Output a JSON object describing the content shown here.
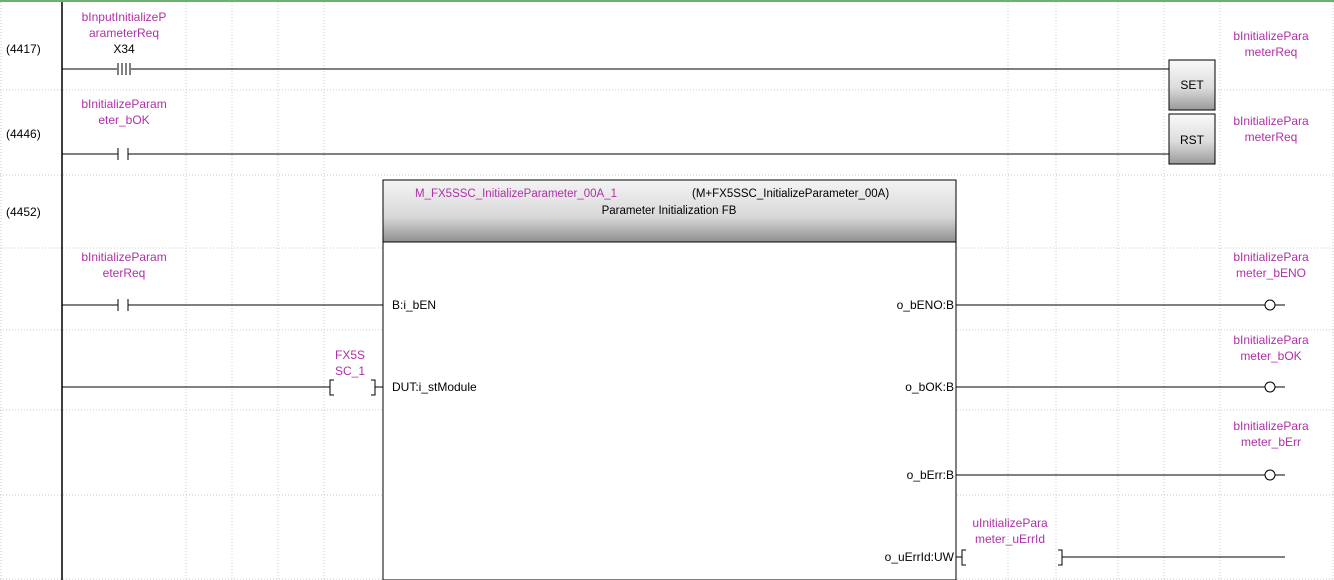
{
  "colors": {
    "variable": "#b030a8",
    "grid": "#b8b8b8",
    "top_border": "#3a9a3a",
    "coil_box_top": "#fafafa",
    "coil_box_bottom": "#9a9a9a",
    "fb_header_top": "#f4f4f4",
    "fb_header_bottom": "#8e8e8e",
    "fb_title": "#b030a8"
  },
  "rungs": [
    {
      "step": "(4417)",
      "contact_label_lines": [
        "bInputInitializeP",
        "arameterReq"
      ],
      "device": "X34",
      "contact_type": "rising-edge",
      "instruction": "SET",
      "coil_label_lines": [
        "bInitializePara",
        "meterReq"
      ]
    },
    {
      "step": "(4446)",
      "contact_label_lines": [
        "bInitializeParam",
        "eter_bOK"
      ],
      "contact_type": "normally-open",
      "instruction": "RST",
      "coil_label_lines": [
        "bInitializePara",
        "meterReq"
      ]
    }
  ],
  "fb_rung": {
    "step": "(4452)",
    "instance_name": "M_FX5SSC_InitializeParameter_00A_1",
    "fb_type": "(M+FX5SSC_InitializeParameter_00A)",
    "fb_description": "Parameter Initialization FB",
    "en_contact_label_lines": [
      "bInitializeParam",
      "eterReq"
    ],
    "dut_label_lines": [
      "FX5S",
      "SC_1"
    ],
    "inputs": [
      {
        "name": "B:i_bEN"
      },
      {
        "name": "DUT:i_stModule"
      }
    ],
    "outputs": [
      {
        "name": "o_bENO:B",
        "label_lines": [
          "bInitializePara",
          "meter_bENO"
        ]
      },
      {
        "name": "o_bOK:B",
        "label_lines": [
          "bInitializePara",
          "meter_bOK"
        ]
      },
      {
        "name": "o_bErr:B",
        "label_lines": [
          "bInitializePara",
          "meter_bErr"
        ]
      },
      {
        "name": "o_uErrId:UW",
        "label_lines": [
          "uInitializePara",
          "meter_uErrId"
        ]
      }
    ]
  }
}
